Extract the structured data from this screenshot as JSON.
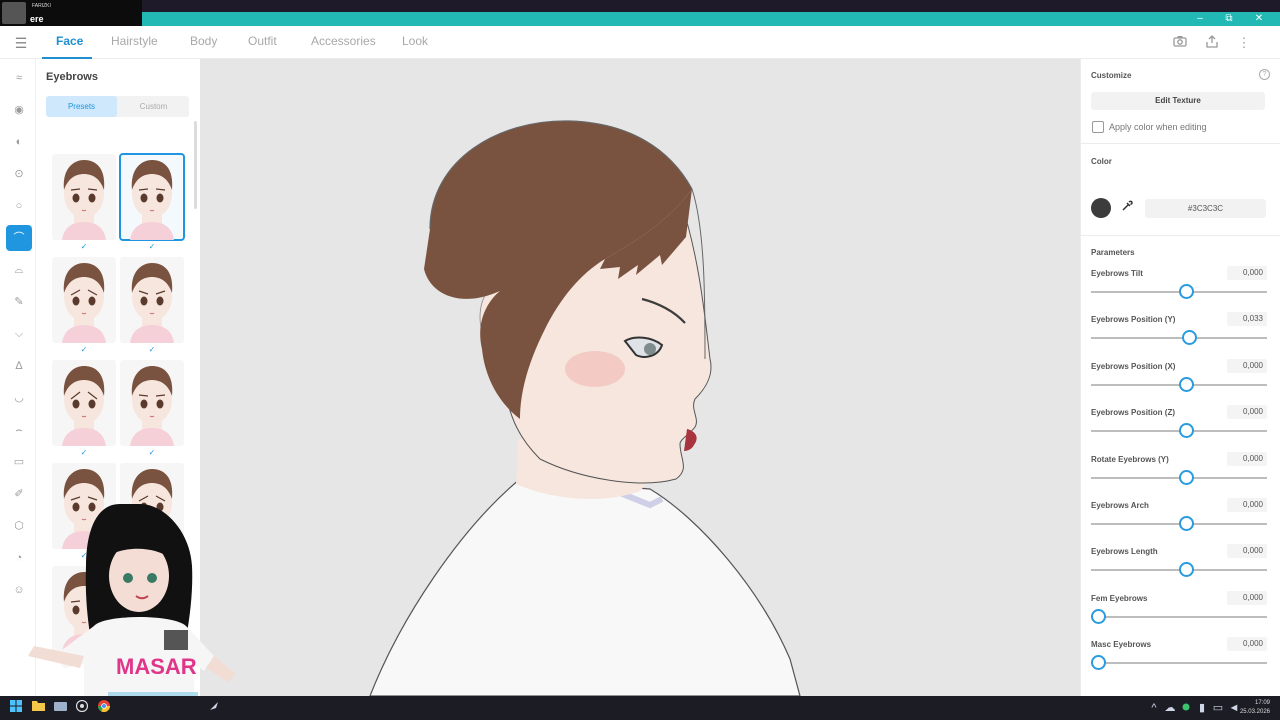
{
  "window": {
    "streamer_name": "FARIZKI",
    "streamer_title": "ere",
    "minimize": "–",
    "restore": "⧉",
    "close": "✕"
  },
  "tabs": [
    {
      "label": "Face",
      "active": true
    },
    {
      "label": "Hairstyle"
    },
    {
      "label": "Body"
    },
    {
      "label": "Outfit"
    },
    {
      "label": "Accessories"
    },
    {
      "label": "Look"
    }
  ],
  "toolbar_icons": [
    "camera-icon",
    "share-icon",
    "more-icon"
  ],
  "sidebar_icons": [
    "face-shape-icon",
    "eye-icon",
    "iris-icon",
    "eyelid-icon",
    "eye-outline-icon",
    "eyebrow-icon",
    "eyelash-icon",
    "brush-icon",
    "eyelash-lower-icon",
    "nose-icon",
    "mouth-icon",
    "lips-icon",
    "teeth-icon",
    "pen-icon",
    "head-shape-icon",
    "ear-icon",
    "face-icon"
  ],
  "presets_panel": {
    "title": "Eyebrows",
    "segment_presets": "Presets",
    "segment_custom": "Custom",
    "check": "✓",
    "item_count": 10,
    "selected_index": 1
  },
  "customize": {
    "title": "Customize",
    "help": "?",
    "edit_texture": "Edit Texture",
    "apply_color_label": "Apply color when editing",
    "apply_color_checked": false,
    "color_label": "Color",
    "color_hex": "#3C3C3C",
    "parameters_label": "Parameters",
    "params": [
      {
        "label": "Eyebrows Tilt",
        "value": "0,000",
        "level": 0.5
      },
      {
        "label": "Eyebrows Position (Y)",
        "value": "0,033",
        "level": 0.517
      },
      {
        "label": "Eyebrows Position (X)",
        "value": "0,000",
        "level": 0.5
      },
      {
        "label": "Eyebrows Position (Z)",
        "value": "0,000",
        "level": 0.5
      },
      {
        "label": "Rotate Eyebrows (Y)",
        "value": "0,000",
        "level": 0.5
      },
      {
        "label": "Eyebrows Arch",
        "value": "0,000",
        "level": 0.5
      },
      {
        "label": "Eyebrows Length",
        "value": "0,000",
        "level": 0.5
      },
      {
        "label": "Fem Eyebrows",
        "value": "0,000",
        "level": 0.0
      },
      {
        "label": "Masc Eyebrows",
        "value": "0,000",
        "level": 0.0
      }
    ]
  },
  "taskbar": {
    "time": "17:09",
    "date": "25.03.2026",
    "app_icons": [
      "windows-icon",
      "file-explorer-icon",
      "folder-icon",
      "chrome-icon",
      "browser-icon",
      "obs-icon",
      "steam-icon"
    ],
    "tray_icons": [
      "chevron-up-icon",
      "cloud-icon",
      "monitor-icon",
      "shield-icon",
      "microphone-icon",
      "network-icon",
      "volume-icon"
    ]
  },
  "overlay": {
    "vtuber_shirt_text": "MASAR"
  },
  "colors": {
    "accent": "#2196E0",
    "titlebar": "#22B8B4",
    "hair": "#7A5340",
    "skin": "#F6E6DD"
  }
}
